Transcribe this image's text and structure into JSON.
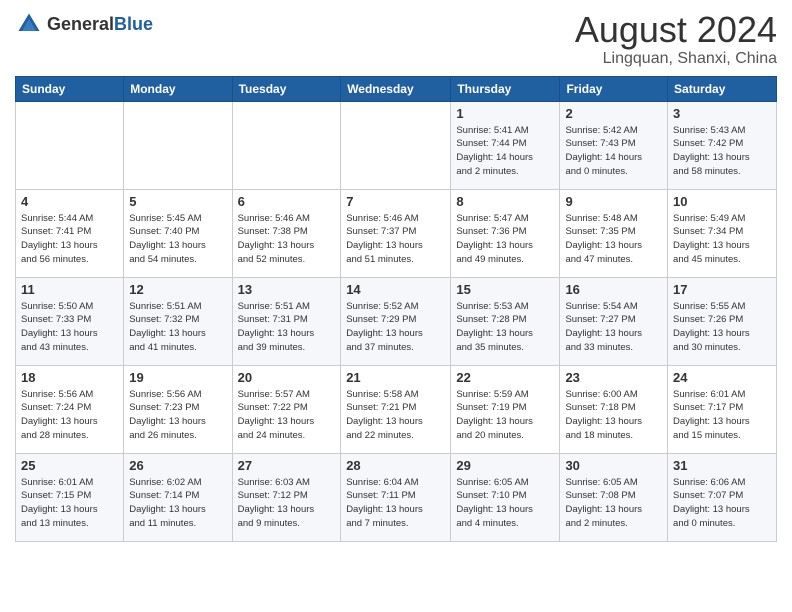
{
  "header": {
    "logo_general": "General",
    "logo_blue": "Blue",
    "title": "August 2024",
    "location": "Lingquan, Shanxi, China"
  },
  "weekdays": [
    "Sunday",
    "Monday",
    "Tuesday",
    "Wednesday",
    "Thursday",
    "Friday",
    "Saturday"
  ],
  "weeks": [
    [
      {
        "day": "",
        "info": ""
      },
      {
        "day": "",
        "info": ""
      },
      {
        "day": "",
        "info": ""
      },
      {
        "day": "",
        "info": ""
      },
      {
        "day": "1",
        "info": "Sunrise: 5:41 AM\nSunset: 7:44 PM\nDaylight: 14 hours\nand 2 minutes."
      },
      {
        "day": "2",
        "info": "Sunrise: 5:42 AM\nSunset: 7:43 PM\nDaylight: 14 hours\nand 0 minutes."
      },
      {
        "day": "3",
        "info": "Sunrise: 5:43 AM\nSunset: 7:42 PM\nDaylight: 13 hours\nand 58 minutes."
      }
    ],
    [
      {
        "day": "4",
        "info": "Sunrise: 5:44 AM\nSunset: 7:41 PM\nDaylight: 13 hours\nand 56 minutes."
      },
      {
        "day": "5",
        "info": "Sunrise: 5:45 AM\nSunset: 7:40 PM\nDaylight: 13 hours\nand 54 minutes."
      },
      {
        "day": "6",
        "info": "Sunrise: 5:46 AM\nSunset: 7:38 PM\nDaylight: 13 hours\nand 52 minutes."
      },
      {
        "day": "7",
        "info": "Sunrise: 5:46 AM\nSunset: 7:37 PM\nDaylight: 13 hours\nand 51 minutes."
      },
      {
        "day": "8",
        "info": "Sunrise: 5:47 AM\nSunset: 7:36 PM\nDaylight: 13 hours\nand 49 minutes."
      },
      {
        "day": "9",
        "info": "Sunrise: 5:48 AM\nSunset: 7:35 PM\nDaylight: 13 hours\nand 47 minutes."
      },
      {
        "day": "10",
        "info": "Sunrise: 5:49 AM\nSunset: 7:34 PM\nDaylight: 13 hours\nand 45 minutes."
      }
    ],
    [
      {
        "day": "11",
        "info": "Sunrise: 5:50 AM\nSunset: 7:33 PM\nDaylight: 13 hours\nand 43 minutes."
      },
      {
        "day": "12",
        "info": "Sunrise: 5:51 AM\nSunset: 7:32 PM\nDaylight: 13 hours\nand 41 minutes."
      },
      {
        "day": "13",
        "info": "Sunrise: 5:51 AM\nSunset: 7:31 PM\nDaylight: 13 hours\nand 39 minutes."
      },
      {
        "day": "14",
        "info": "Sunrise: 5:52 AM\nSunset: 7:29 PM\nDaylight: 13 hours\nand 37 minutes."
      },
      {
        "day": "15",
        "info": "Sunrise: 5:53 AM\nSunset: 7:28 PM\nDaylight: 13 hours\nand 35 minutes."
      },
      {
        "day": "16",
        "info": "Sunrise: 5:54 AM\nSunset: 7:27 PM\nDaylight: 13 hours\nand 33 minutes."
      },
      {
        "day": "17",
        "info": "Sunrise: 5:55 AM\nSunset: 7:26 PM\nDaylight: 13 hours\nand 30 minutes."
      }
    ],
    [
      {
        "day": "18",
        "info": "Sunrise: 5:56 AM\nSunset: 7:24 PM\nDaylight: 13 hours\nand 28 minutes."
      },
      {
        "day": "19",
        "info": "Sunrise: 5:56 AM\nSunset: 7:23 PM\nDaylight: 13 hours\nand 26 minutes."
      },
      {
        "day": "20",
        "info": "Sunrise: 5:57 AM\nSunset: 7:22 PM\nDaylight: 13 hours\nand 24 minutes."
      },
      {
        "day": "21",
        "info": "Sunrise: 5:58 AM\nSunset: 7:21 PM\nDaylight: 13 hours\nand 22 minutes."
      },
      {
        "day": "22",
        "info": "Sunrise: 5:59 AM\nSunset: 7:19 PM\nDaylight: 13 hours\nand 20 minutes."
      },
      {
        "day": "23",
        "info": "Sunrise: 6:00 AM\nSunset: 7:18 PM\nDaylight: 13 hours\nand 18 minutes."
      },
      {
        "day": "24",
        "info": "Sunrise: 6:01 AM\nSunset: 7:17 PM\nDaylight: 13 hours\nand 15 minutes."
      }
    ],
    [
      {
        "day": "25",
        "info": "Sunrise: 6:01 AM\nSunset: 7:15 PM\nDaylight: 13 hours\nand 13 minutes."
      },
      {
        "day": "26",
        "info": "Sunrise: 6:02 AM\nSunset: 7:14 PM\nDaylight: 13 hours\nand 11 minutes."
      },
      {
        "day": "27",
        "info": "Sunrise: 6:03 AM\nSunset: 7:12 PM\nDaylight: 13 hours\nand 9 minutes."
      },
      {
        "day": "28",
        "info": "Sunrise: 6:04 AM\nSunset: 7:11 PM\nDaylight: 13 hours\nand 7 minutes."
      },
      {
        "day": "29",
        "info": "Sunrise: 6:05 AM\nSunset: 7:10 PM\nDaylight: 13 hours\nand 4 minutes."
      },
      {
        "day": "30",
        "info": "Sunrise: 6:05 AM\nSunset: 7:08 PM\nDaylight: 13 hours\nand 2 minutes."
      },
      {
        "day": "31",
        "info": "Sunrise: 6:06 AM\nSunset: 7:07 PM\nDaylight: 13 hours\nand 0 minutes."
      }
    ]
  ]
}
